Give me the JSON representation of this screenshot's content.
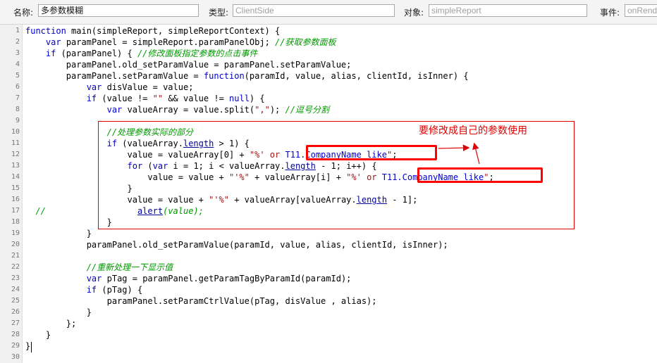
{
  "header": {
    "name_label": "名称:",
    "name_value": "多参数模糊",
    "type_label": "类型:",
    "type_placeholder": "ClientSide",
    "object_label": "对象:",
    "object_placeholder": "simpleReport",
    "event_label": "事件:",
    "event_placeholder": "onRender"
  },
  "editor": {
    "lines": [
      {
        "no": "1",
        "segs": [
          {
            "t": "kw",
            "v": "function"
          },
          {
            "t": "",
            "v": " main(simpleReport, simpleReportContext) {"
          }
        ]
      },
      {
        "no": "2",
        "segs": [
          {
            "t": "",
            "v": "    "
          },
          {
            "t": "kw",
            "v": "var"
          },
          {
            "t": "",
            "v": " paramPanel = simpleReport.paramPanelObj; "
          },
          {
            "t": "cm",
            "v": "//获取参数面板"
          }
        ]
      },
      {
        "no": "3",
        "segs": [
          {
            "t": "",
            "v": "    "
          },
          {
            "t": "kw",
            "v": "if"
          },
          {
            "t": "",
            "v": " (paramPanel) { "
          },
          {
            "t": "cm",
            "v": "//修改面板指定参数的点击事件"
          }
        ]
      },
      {
        "no": "4",
        "segs": [
          {
            "t": "",
            "v": "        paramPanel.old_setParamValue = paramPanel.setParamValue;"
          }
        ]
      },
      {
        "no": "5",
        "segs": [
          {
            "t": "",
            "v": "        paramPanel.setParamValue = "
          },
          {
            "t": "kw",
            "v": "function"
          },
          {
            "t": "",
            "v": "(paramId, value, alias, clientId, isInner) {"
          }
        ]
      },
      {
        "no": "6",
        "segs": [
          {
            "t": "",
            "v": "            "
          },
          {
            "t": "kw",
            "v": "var"
          },
          {
            "t": "",
            "v": " disValue = value;"
          }
        ]
      },
      {
        "no": "7",
        "segs": [
          {
            "t": "",
            "v": "            "
          },
          {
            "t": "kw",
            "v": "if"
          },
          {
            "t": "",
            "v": " (value != "
          },
          {
            "t": "st",
            "v": "\"\""
          },
          {
            "t": "",
            "v": " && value != "
          },
          {
            "t": "kw",
            "v": "null"
          },
          {
            "t": "",
            "v": ") {"
          }
        ]
      },
      {
        "no": "8",
        "segs": [
          {
            "t": "",
            "v": "                "
          },
          {
            "t": "kw",
            "v": "var"
          },
          {
            "t": "",
            "v": " valueArray = value.split("
          },
          {
            "t": "st",
            "v": "\",\""
          },
          {
            "t": "",
            "v": "); "
          },
          {
            "t": "cm",
            "v": "//逗号分割"
          }
        ]
      },
      {
        "no": "9",
        "segs": []
      },
      {
        "no": "10",
        "segs": [
          {
            "t": "",
            "v": "                "
          },
          {
            "t": "cm",
            "v": "//处理参数实际的部分"
          }
        ]
      },
      {
        "no": "11",
        "segs": [
          {
            "t": "",
            "v": "                "
          },
          {
            "t": "kw",
            "v": "if"
          },
          {
            "t": "",
            "v": " (valueArray."
          },
          {
            "t": "ul",
            "v": "length"
          },
          {
            "t": "",
            "v": " > 1) {"
          }
        ]
      },
      {
        "no": "12",
        "segs": [
          {
            "t": "",
            "v": "                    value = valueArray[0] + "
          },
          {
            "t": "st",
            "v": "\"%' or "
          },
          {
            "t": "kw",
            "v": "T11.CompanyName like"
          },
          {
            "t": "st",
            "v": "\""
          },
          {
            "t": "",
            "v": ";"
          }
        ]
      },
      {
        "no": "13",
        "segs": [
          {
            "t": "",
            "v": "                    "
          },
          {
            "t": "kw",
            "v": "for"
          },
          {
            "t": "",
            "v": " ("
          },
          {
            "t": "kw",
            "v": "var"
          },
          {
            "t": "",
            "v": " i = 1; i < valueArray."
          },
          {
            "t": "ul",
            "v": "length"
          },
          {
            "t": "",
            "v": " - 1; i++) {"
          }
        ]
      },
      {
        "no": "14",
        "segs": [
          {
            "t": "",
            "v": "                        value = value + "
          },
          {
            "t": "st",
            "v": "\"'%\""
          },
          {
            "t": "",
            "v": " + valueArray[i] + "
          },
          {
            "t": "st",
            "v": "\"%' or "
          },
          {
            "t": "kw",
            "v": "T11.CompanyName like"
          },
          {
            "t": "st",
            "v": "\""
          },
          {
            "t": "",
            "v": ";"
          }
        ]
      },
      {
        "no": "15",
        "segs": [
          {
            "t": "",
            "v": "                    }"
          }
        ]
      },
      {
        "no": "16",
        "segs": [
          {
            "t": "",
            "v": "                    value = value + "
          },
          {
            "t": "st",
            "v": "\"'%\""
          },
          {
            "t": "",
            "v": " + valueArray[valueArray."
          },
          {
            "t": "ul",
            "v": "length"
          },
          {
            "t": "",
            "v": " - 1];"
          }
        ]
      },
      {
        "no": "17",
        "segs": [
          {
            "t": "cm",
            "v": "  //"
          },
          {
            "t": "",
            "v": "                  "
          },
          {
            "t": "ul",
            "v": "alert"
          },
          {
            "t": "cm",
            "v": "(value);"
          }
        ]
      },
      {
        "no": "18",
        "segs": [
          {
            "t": "",
            "v": "                }"
          }
        ]
      },
      {
        "no": "19",
        "segs": [
          {
            "t": "",
            "v": "            }"
          }
        ]
      },
      {
        "no": "20",
        "segs": [
          {
            "t": "",
            "v": "            paramPanel.old_setParamValue(paramId, value, alias, clientId, isInner);"
          }
        ]
      },
      {
        "no": "21",
        "segs": []
      },
      {
        "no": "22",
        "segs": [
          {
            "t": "",
            "v": "            "
          },
          {
            "t": "cm",
            "v": "//重新处理一下显示值"
          }
        ]
      },
      {
        "no": "23",
        "segs": [
          {
            "t": "",
            "v": "            "
          },
          {
            "t": "kw",
            "v": "var"
          },
          {
            "t": "",
            "v": " pTag = paramPanel.getParamTagByParamId(paramId);"
          }
        ]
      },
      {
        "no": "24",
        "segs": [
          {
            "t": "",
            "v": "            "
          },
          {
            "t": "kw",
            "v": "if"
          },
          {
            "t": "",
            "v": " (pTag) {"
          }
        ]
      },
      {
        "no": "25",
        "segs": [
          {
            "t": "",
            "v": "                paramPanel.setParamCtrlValue(pTag, disValue , alias);"
          }
        ]
      },
      {
        "no": "26",
        "segs": [
          {
            "t": "",
            "v": "            }"
          }
        ]
      },
      {
        "no": "27",
        "segs": [
          {
            "t": "",
            "v": "        };"
          }
        ]
      },
      {
        "no": "28",
        "segs": [
          {
            "t": "",
            "v": "    }"
          }
        ]
      },
      {
        "no": "29",
        "segs": [
          {
            "t": "",
            "v": "}"
          }
        ]
      },
      {
        "no": "30",
        "segs": []
      }
    ]
  },
  "annotation": {
    "text": "要修改成自己的参数使用",
    "color": "#e10000"
  },
  "colors": {
    "keyword": "#0000cc",
    "comment": "#009900",
    "string": "#a31515",
    "highlight": "#ff0000"
  }
}
